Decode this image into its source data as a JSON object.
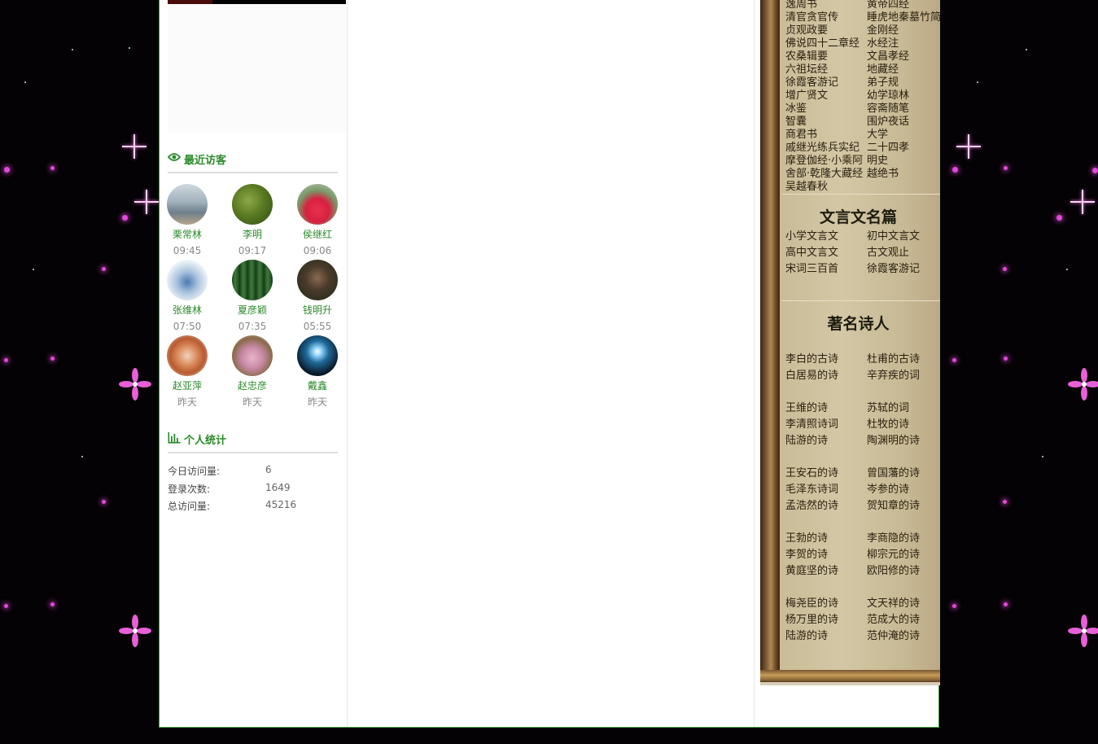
{
  "visitors_section": {
    "title": "最近访客",
    "visitors": [
      {
        "name": "栗常林",
        "time": "09:45"
      },
      {
        "name": "李明",
        "time": "09:17"
      },
      {
        "name": "侯继红",
        "time": "09:06"
      },
      {
        "name": "张维林",
        "time": "07:50"
      },
      {
        "name": "夏彦颖",
        "time": "07:35"
      },
      {
        "name": "钱明升",
        "time": "05:55"
      },
      {
        "name": "赵亚萍",
        "time": "昨天"
      },
      {
        "name": "赵忠彦",
        "time": "昨天"
      },
      {
        "name": "戴鑫",
        "time": "昨天"
      }
    ]
  },
  "stats_section": {
    "title": "个人统计",
    "rows": [
      {
        "label": "今日访问量:",
        "value": "6"
      },
      {
        "label": "登录次数:",
        "value": "1649"
      },
      {
        "label": "总访问量:",
        "value": "45216"
      }
    ]
  },
  "classics": {
    "rows": [
      [
        "逸周书",
        "黄帝四经"
      ],
      [
        "清官贪官传",
        "睡虎地秦墓竹简"
      ],
      [
        "贞观政要",
        "金刚经"
      ],
      [
        "佛说四十二章经",
        "水经注"
      ],
      [
        "农桑辑要",
        "文昌孝经"
      ],
      [
        "六祖坛经",
        "地藏经"
      ],
      [
        "徐霞客游记",
        "弟子规"
      ],
      [
        "增广贤文",
        "幼学琼林"
      ],
      [
        "冰鉴",
        "容斋随笔"
      ],
      [
        "智囊",
        "围炉夜话"
      ],
      [
        "商君书",
        "大学"
      ],
      [
        "戚继光练兵实纪",
        "二十四孝"
      ],
      [
        "摩登伽经·小乘阿",
        "明史"
      ],
      [
        "舍部·乾隆大藏经",
        "越绝书"
      ],
      [
        "吴越春秋",
        ""
      ]
    ]
  },
  "wenyan": {
    "title": "文言文名篇",
    "rows": [
      [
        "小学文言文",
        "初中文言文"
      ],
      [
        "高中文言文",
        "古文观止"
      ],
      [
        "宋词三百首",
        "徐霞客游记"
      ]
    ]
  },
  "poets": {
    "title": "著名诗人",
    "groups": [
      [
        [
          "李白的古诗",
          "杜甫的古诗"
        ],
        [
          "白居易的诗",
          "辛弃疾的词"
        ]
      ],
      [
        [
          "王维的诗",
          "苏轼的词"
        ],
        [
          "李清照诗词",
          "杜牧的诗"
        ],
        [
          "陆游的诗",
          "陶渊明的诗"
        ]
      ],
      [
        [
          "王安石的诗",
          "曾国藩的诗"
        ],
        [
          "毛泽东诗词",
          "岑参的诗"
        ],
        [
          "孟浩然的诗",
          "贺知章的诗"
        ]
      ],
      [
        [
          "王勃的诗",
          "李商隐的诗"
        ],
        [
          "李贺的诗",
          "柳宗元的诗"
        ],
        [
          "黄庭坚的诗",
          "欧阳修的诗"
        ]
      ],
      [
        [
          "梅尧臣的诗",
          "文天祥的诗"
        ],
        [
          "杨万里的诗",
          "范成大的诗"
        ],
        [
          "陆游的诗",
          "范仲淹的诗"
        ]
      ]
    ]
  },
  "colors": {
    "accent_green": "#2a8a2a",
    "background": "#050205",
    "sparkle": "#e04ad8",
    "scroll_paper": "#d3c7a5"
  }
}
